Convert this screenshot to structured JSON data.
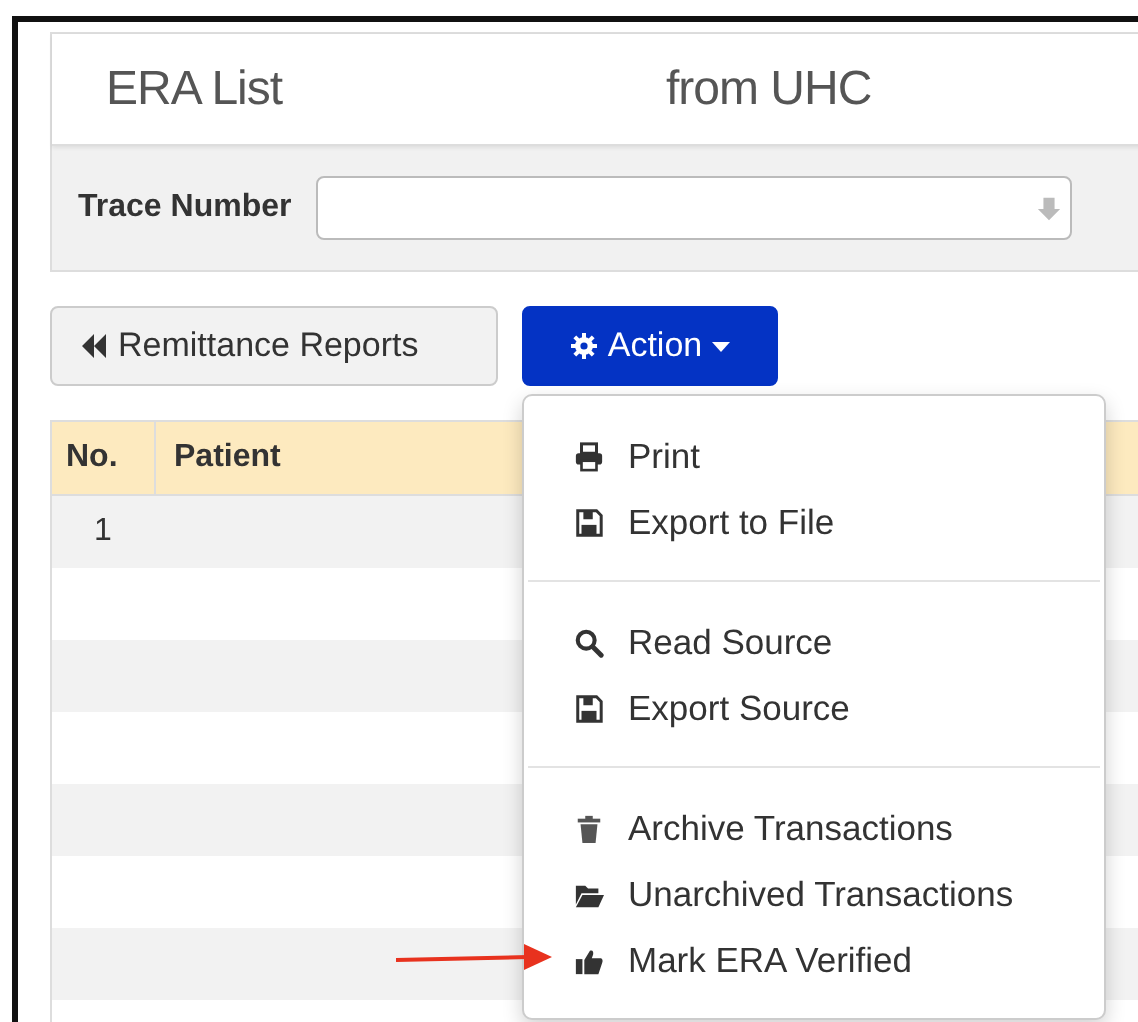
{
  "header": {
    "title": "ERA List",
    "subtitle": "from UHC"
  },
  "filter": {
    "label": "Trace Number"
  },
  "buttons": [
    {
      "label": "Remittance Reports",
      "kind": "back"
    },
    {
      "label": "Action",
      "kind": "dropdown"
    }
  ],
  "table": {
    "columns": [
      "No.",
      "Patient"
    ],
    "rows": [
      {
        "no": "1"
      }
    ]
  },
  "menu": {
    "groups": [
      [
        {
          "label": "Print",
          "kind": "print"
        },
        {
          "label": "Export to File",
          "kind": "save"
        }
      ],
      [
        {
          "label": "Read Source",
          "kind": "search"
        },
        {
          "label": "Export Source",
          "kind": "save"
        }
      ],
      [
        {
          "label": "Archive Transactions",
          "kind": "trash"
        },
        {
          "label": "Unarchived Transactions",
          "kind": "folder"
        },
        {
          "label": "Mark ERA Verified",
          "kind": "thumb"
        }
      ]
    ]
  }
}
